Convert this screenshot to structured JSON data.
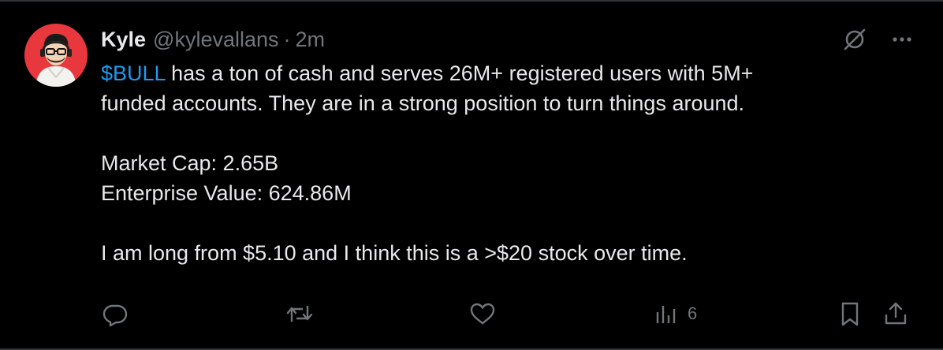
{
  "tweet": {
    "author": {
      "display_name": "Kyle",
      "handle": "@kylevallans",
      "separator": "·",
      "time": "2m"
    },
    "text": {
      "cashtag": "$BULL",
      "line1_rest": " has a ton of cash and serves 26M+ registered users with 5M+",
      "line2": "funded accounts. They are in a strong position to turn things around.",
      "line3": "Market Cap: 2.65B",
      "line4": "Enterprise Value: 624.86M",
      "line5": "I am long from $5.10 and I think this is a >$20 stock over time."
    },
    "metrics": {
      "views": "6"
    },
    "icons": {
      "grok": "grok-icon",
      "more": "more-icon",
      "reply": "reply-icon",
      "repost": "repost-icon",
      "like": "heart-icon",
      "views": "views-icon",
      "bookmark": "bookmark-icon",
      "share": "share-icon"
    },
    "colors": {
      "background": "#000000",
      "text": "#e7e9ea",
      "secondary": "#71767b",
      "link": "#1d9bf0",
      "avatar_bg": "#e8383d"
    }
  }
}
